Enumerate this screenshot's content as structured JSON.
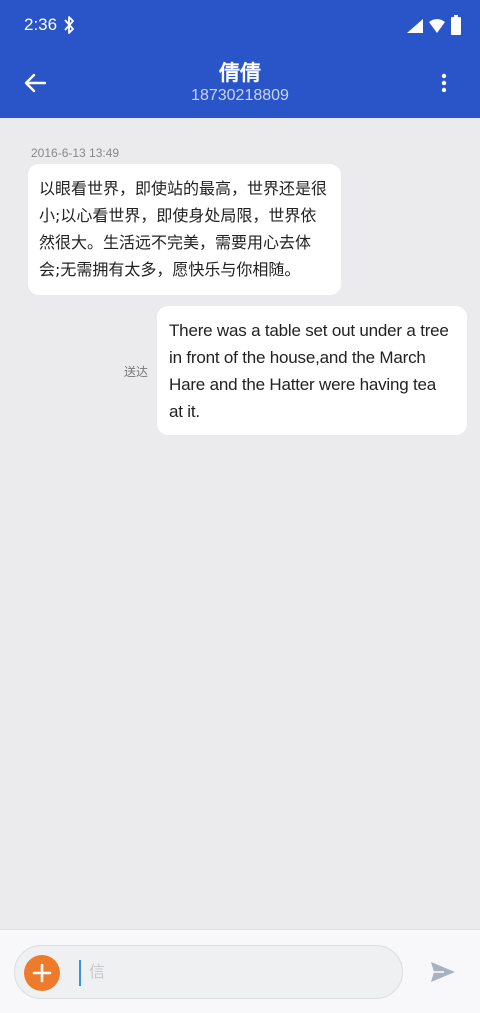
{
  "status_bar": {
    "time": "2:36"
  },
  "header": {
    "title": "倩倩",
    "subtitle": "18730218809"
  },
  "conversation": {
    "timestamp": "2016-6-13 13:49",
    "incoming_message": {
      "lines": [
        "以眼看世界，即使站的最高，世界还是很",
        "小;以心看世界，即使身处局限，世界依",
        "然很大。生活远不完美，需要用心去体",
        "会;无需拥有太多，愿快乐与你相随。"
      ]
    },
    "outgoing_message": {
      "lines": [
        "There was a table set out under a tree",
        "in front of the house,and the March",
        "Hare and the Hatter were having tea",
        "at it."
      ],
      "status": "送达"
    }
  },
  "composer": {
    "placeholder": "信",
    "value": ""
  },
  "colors": {
    "app_bar": "#2a55c8",
    "background": "#ebebed",
    "add_button": "#ee7a2c",
    "send_icon": "#a8b3c2"
  },
  "icons": {
    "back": "arrow-left-icon",
    "more": "more-vert-icon",
    "add": "plus-icon",
    "send": "send-icon"
  }
}
